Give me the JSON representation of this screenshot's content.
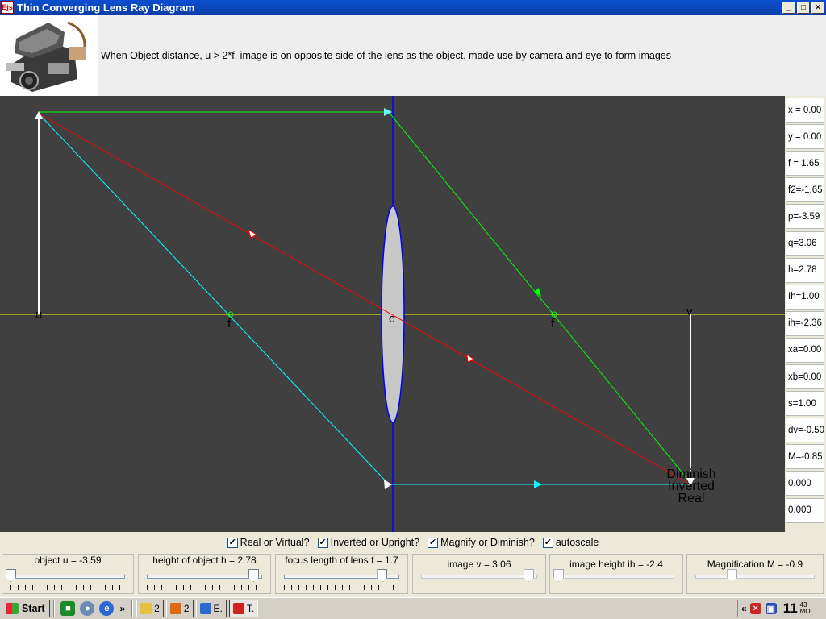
{
  "window": {
    "icon": "Ejs",
    "title": "Thin Converging Lens Ray Diagram",
    "minimize": "_",
    "maximize": "□",
    "close": "×"
  },
  "header": {
    "description": "When Object distance, u > 2*f, image is on opposite side of the lens as the object, made use by camera and eye to form images"
  },
  "diagram": {
    "labels": {
      "object": "u",
      "focus_left": "f",
      "center": "c",
      "focus_right": "f",
      "image": "v"
    },
    "image_description": [
      "Diminish",
      "Inverted",
      "Real"
    ],
    "colors": {
      "background": "#404040",
      "axis": "#ffff00",
      "lens_line": "#0000ff",
      "lens_fill": "#c8c8c8",
      "ray_parallel": "#00ff00",
      "ray_center": "#ff0000",
      "ray_focus": "#00ffff",
      "object_arrow": "#ffffff"
    }
  },
  "readouts": [
    "x = 0.00",
    "y = 0.00",
    "f = 1.65",
    "f2=-1.65",
    "p=-3.59",
    "q=3.06",
    "h=2.78",
    "Ih=1.00",
    "ih=-2.36",
    "xa=0.00",
    "xb=0.00",
    "s=1.00",
    "dv=-0.50",
    "M=-0.85",
    "0.000",
    "0.000"
  ],
  "checkboxes": [
    {
      "label": "Real or Virtual?",
      "checked": true
    },
    {
      "label": "Inverted or Upright?",
      "checked": true
    },
    {
      "label": "Magnify or Diminish?",
      "checked": true
    },
    {
      "label": "autoscale",
      "checked": true
    }
  ],
  "sliders": [
    {
      "label": "object u  = -3.59",
      "fraction": 0.0,
      "enabled": true
    },
    {
      "label": "height of object h = 2.78",
      "fraction": 1.0,
      "enabled": true
    },
    {
      "label": "focus length of lens f = 1.7",
      "fraction": 0.92,
      "enabled": true
    },
    {
      "label": "image v = 3.06",
      "fraction": 1.0,
      "enabled": false
    },
    {
      "label": "image height ih = -2.4",
      "fraction": 0.0,
      "enabled": false
    },
    {
      "label": "Magnification M = -0.9",
      "fraction": 0.33,
      "enabled": false
    }
  ],
  "taskbar": {
    "start": "Start",
    "more": "»",
    "tasks": [
      {
        "label": "2",
        "icon": "folder-icon"
      },
      {
        "label": "2",
        "icon": "firefox-icon"
      },
      {
        "label": "E.",
        "icon": "ie-icon"
      },
      {
        "label": "T.",
        "icon": "ejs-icon",
        "active": true
      }
    ],
    "tray_expand": "«",
    "clock_hour": "11",
    "clock_minute": "43",
    "clock_period": "MO"
  }
}
